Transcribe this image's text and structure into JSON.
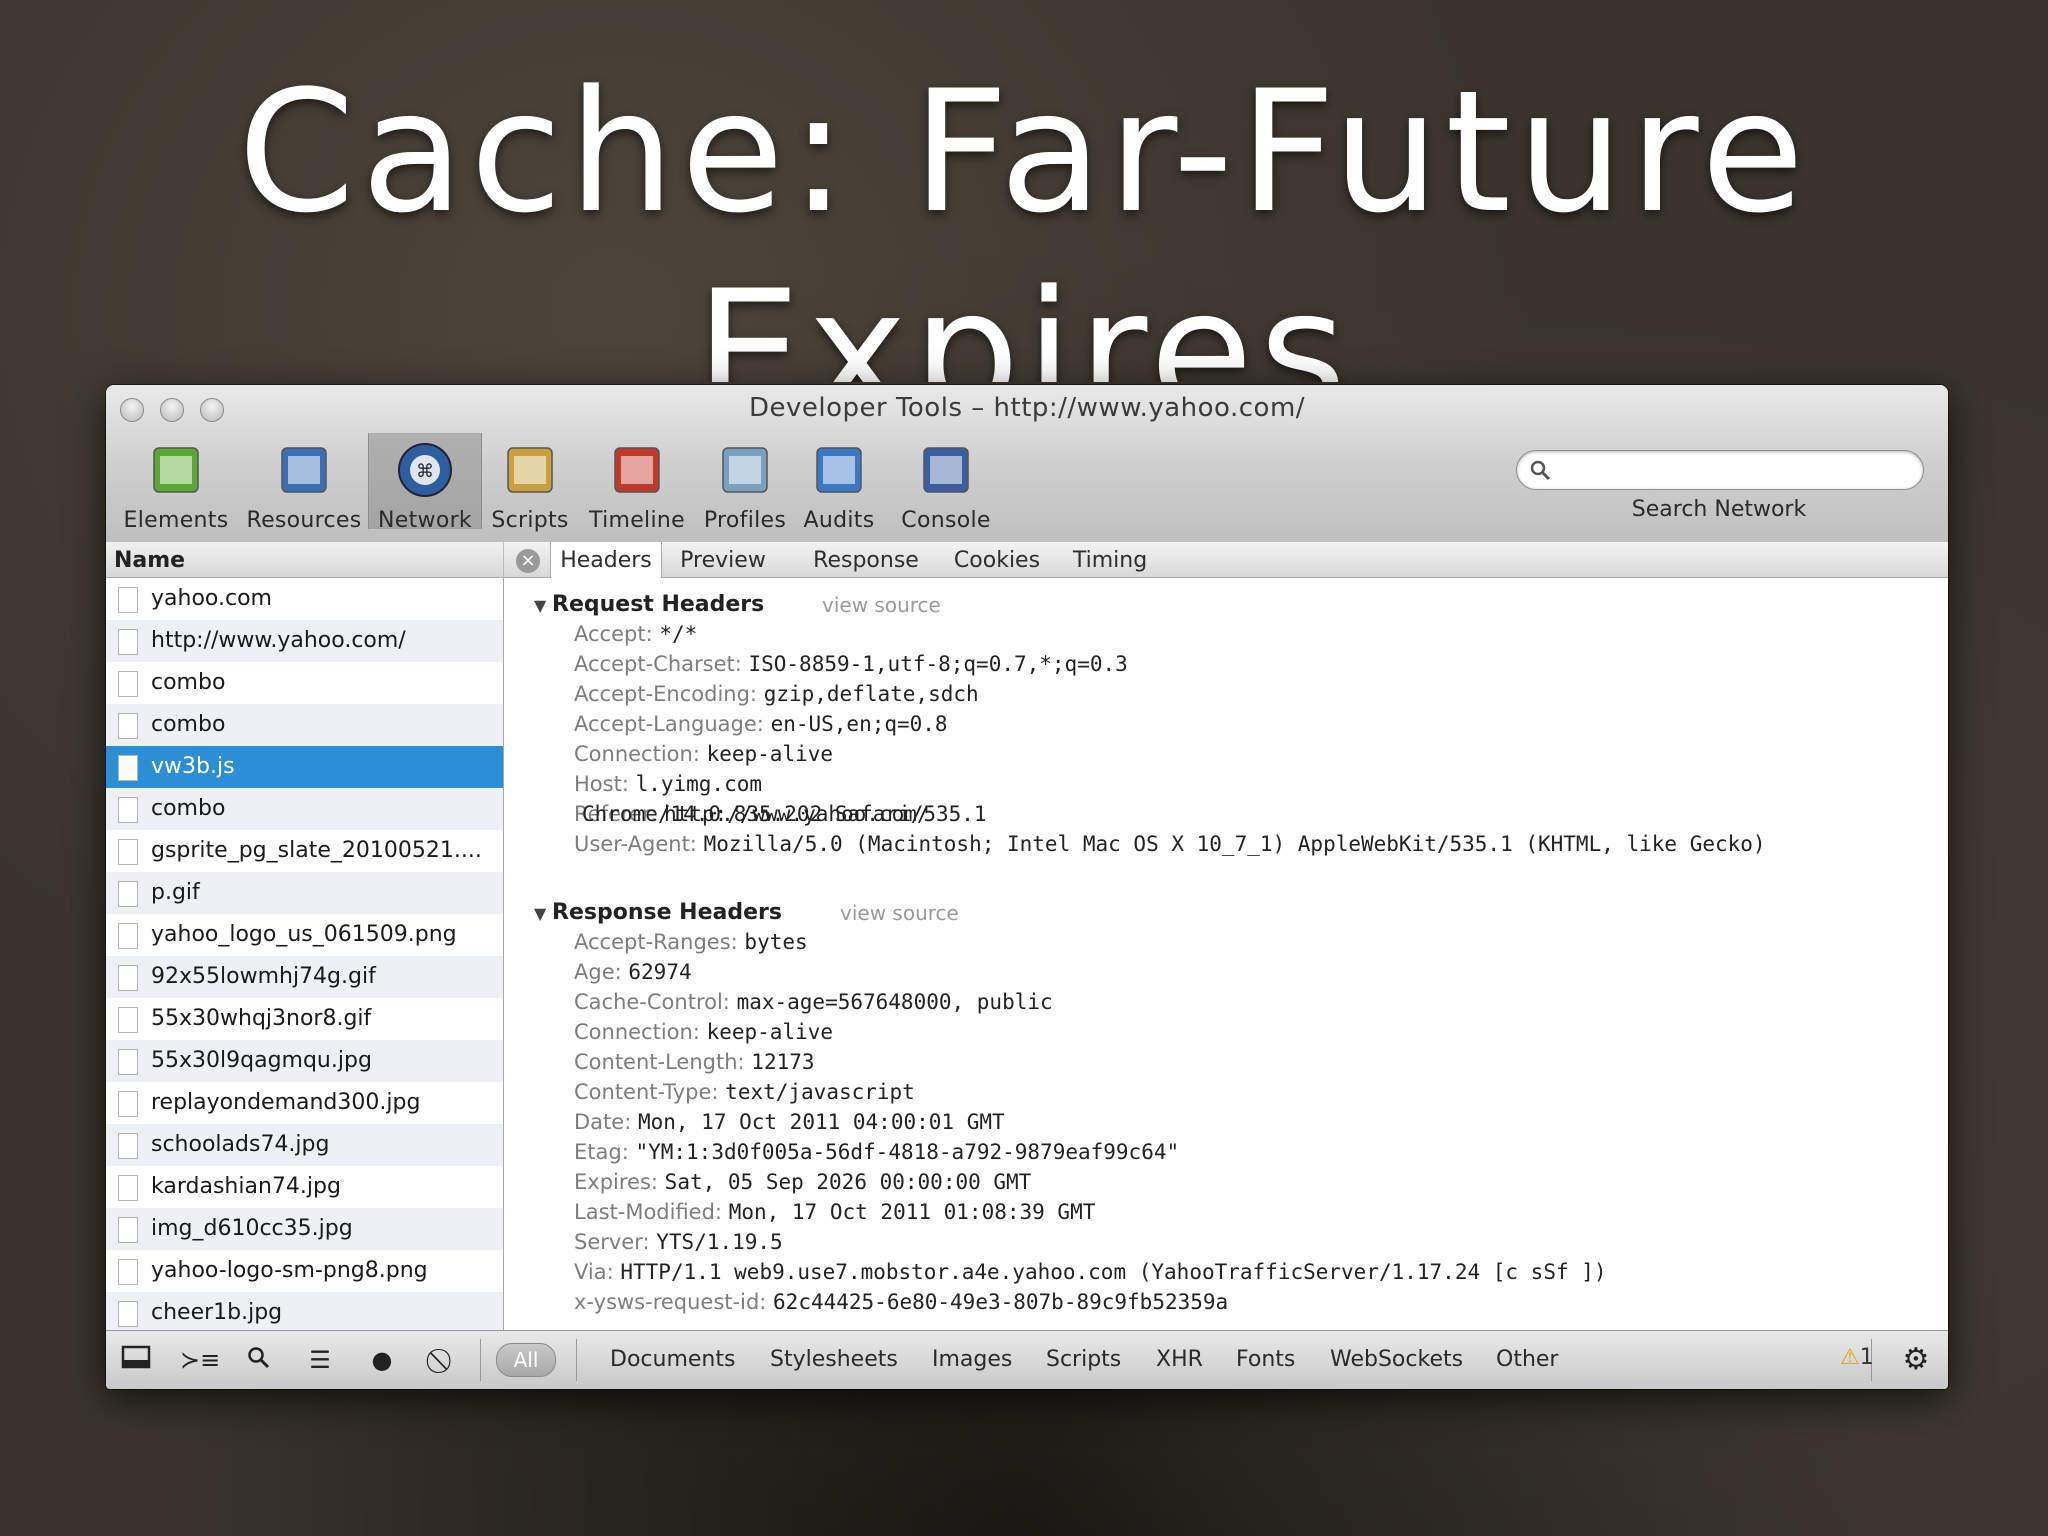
{
  "slide": {
    "title": "Cache: Far-Future Expires"
  },
  "window": {
    "title": "Developer Tools – http://www.yahoo.com/"
  },
  "toolbar": [
    {
      "label": "Elements",
      "icon": "elements-icon"
    },
    {
      "label": "Resources",
      "icon": "resources-icon"
    },
    {
      "label": "Network",
      "icon": "network-icon",
      "active": true
    },
    {
      "label": "Scripts",
      "icon": "scripts-icon"
    },
    {
      "label": "Timeline",
      "icon": "timeline-icon"
    },
    {
      "label": "Profiles",
      "icon": "profiles-icon"
    },
    {
      "label": "Audits",
      "icon": "audits-icon"
    },
    {
      "label": "Console",
      "icon": "console-icon"
    }
  ],
  "search": {
    "label": "Search Network",
    "value": ""
  },
  "list": {
    "header": "Name",
    "items": [
      "yahoo.com",
      "http://www.yahoo.com/",
      "combo",
      "combo",
      "vw3b.js",
      "combo",
      "gsprite_pg_slate_20100521....",
      "p.gif",
      "yahoo_logo_us_061509.png",
      "92x55lowmhj74g.gif",
      "55x30whqj3nor8.gif",
      "55x30l9qagmqu.jpg",
      "replayondemand300.jpg",
      "schoolads74.jpg",
      "kardashian74.jpg",
      "img_d610cc35.jpg",
      "yahoo-logo-sm-png8.png",
      "cheer1b.jpg"
    ],
    "selected": "vw3b.js"
  },
  "tabs": [
    "Headers",
    "Preview",
    "Response",
    "Cookies",
    "Timing"
  ],
  "active_tab": "Headers",
  "request": {
    "title": "Request Headers",
    "view_source": "view source",
    "headers": [
      {
        "k": "Accept:",
        "v": "*/*"
      },
      {
        "k": "Accept-Charset:",
        "v": "ISO-8859-1,utf-8;q=0.7,*;q=0.3"
      },
      {
        "k": "Accept-Encoding:",
        "v": "gzip,deflate,sdch"
      },
      {
        "k": "Accept-Language:",
        "v": "en-US,en;q=0.8"
      },
      {
        "k": "Connection:",
        "v": "keep-alive"
      },
      {
        "k": "Host:",
        "v": "l.yimg.com"
      },
      {
        "k": "Referer:",
        "v": "http://www.yahoo.com/"
      },
      {
        "k": "User-Agent:",
        "v": "Mozilla/5.0 (Macintosh; Intel Mac OS X 10_7_1) AppleWebKit/535.1 (KHTML, like Gecko)"
      }
    ],
    "ua_continuation": "Chrome/14.0.835.202 Safari/535.1"
  },
  "response": {
    "title": "Response Headers",
    "view_source": "view source",
    "headers": [
      {
        "k": "Accept-Ranges:",
        "v": "bytes"
      },
      {
        "k": "Age:",
        "v": "62974"
      },
      {
        "k": "Cache-Control:",
        "v": "max-age=567648000, public"
      },
      {
        "k": "Connection:",
        "v": "keep-alive"
      },
      {
        "k": "Content-Length:",
        "v": "12173"
      },
      {
        "k": "Content-Type:",
        "v": "text/javascript"
      },
      {
        "k": "Date:",
        "v": "Mon, 17 Oct 2011 04:00:01 GMT"
      },
      {
        "k": "Etag:",
        "v": "\"YM:1:3d0f005a-56df-4818-a792-9879eaf99c64\""
      },
      {
        "k": "Expires:",
        "v": "Sat, 05 Sep 2026 00:00:00 GMT"
      },
      {
        "k": "Last-Modified:",
        "v": "Mon, 17 Oct 2011 01:08:39 GMT"
      },
      {
        "k": "Server:",
        "v": "YTS/1.19.5"
      },
      {
        "k": "Via:",
        "v": "HTTP/1.1 web9.use7.mobstor.a4e.yahoo.com (YahooTrafficServer/1.17.24 [c sSf ])"
      },
      {
        "k": "x-ysws-request-id:",
        "v": "62c44425-6e80-49e3-807b-89c9fb52359a"
      }
    ]
  },
  "statusbar": {
    "filters": [
      "All",
      "Documents",
      "Stylesheets",
      "Images",
      "Scripts",
      "XHR",
      "Fonts",
      "WebSockets",
      "Other"
    ],
    "warning_count": "1"
  },
  "colors": {
    "selection": "#2c8ed4",
    "background": "#3a342d"
  }
}
